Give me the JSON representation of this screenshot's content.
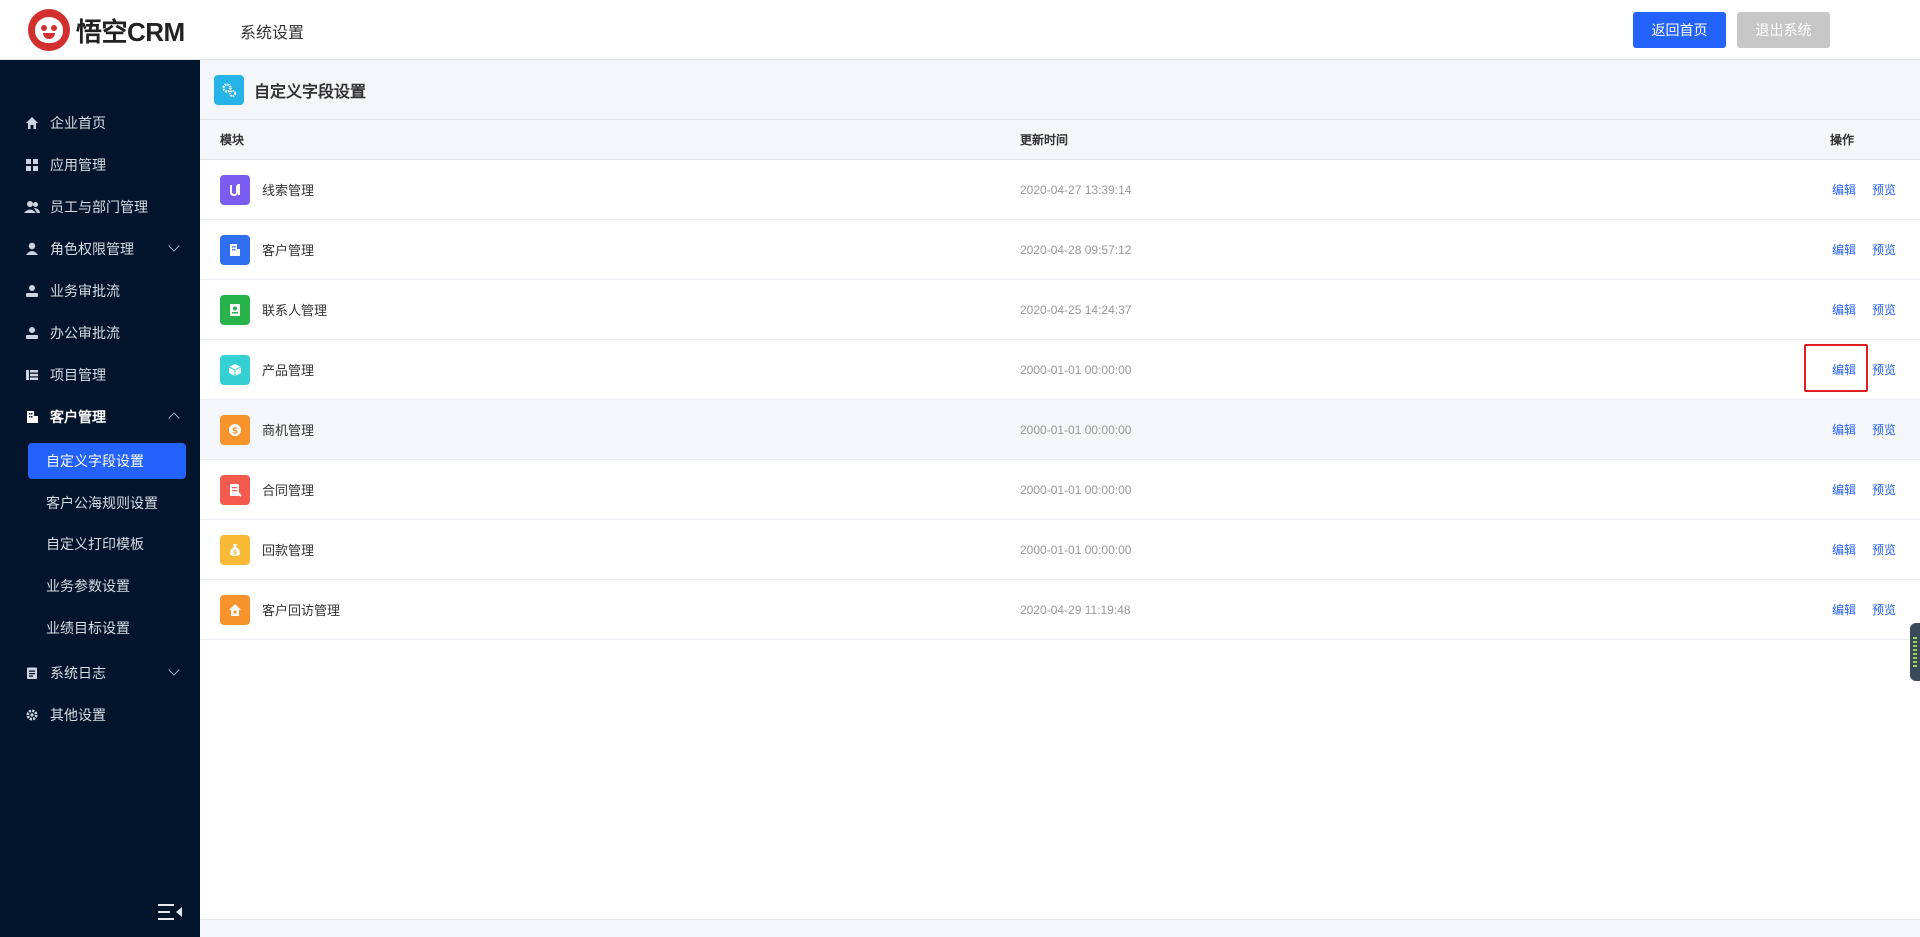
{
  "header": {
    "logo_text": "悟空CRM",
    "title": "系统设置",
    "home_button": "返回首页",
    "exit_button": "退出系统"
  },
  "sidebar": {
    "items": [
      {
        "label": "企业首页",
        "icon": "home-icon"
      },
      {
        "label": "应用管理",
        "icon": "apps-grid-icon"
      },
      {
        "label": "员工与部门管理",
        "icon": "users-icon"
      },
      {
        "label": "角色权限管理",
        "icon": "user-icon"
      },
      {
        "label": "业务审批流",
        "icon": "approval-icon"
      },
      {
        "label": "办公审批流",
        "icon": "approval-icon"
      },
      {
        "label": "项目管理",
        "icon": "project-icon"
      },
      {
        "label": "客户管理",
        "icon": "building-icon"
      },
      {
        "label": "系统日志",
        "icon": "log-icon"
      },
      {
        "label": "其他设置",
        "icon": "gear-icon"
      }
    ],
    "sub_items": [
      {
        "label": "自定义字段设置",
        "active": true
      },
      {
        "label": "客户公海规则设置",
        "active": false
      },
      {
        "label": "自定义打印模板",
        "active": false
      },
      {
        "label": "业务参数设置",
        "active": false
      },
      {
        "label": "业绩目标设置",
        "active": false
      }
    ]
  },
  "page": {
    "title": "自定义字段设置",
    "columns": {
      "module": "模块",
      "time": "更新时间",
      "action": "操作"
    },
    "edit_label": "编辑",
    "preview_label": "预览",
    "rows": [
      {
        "name": "线索管理",
        "time": "2020-04-27 13:39:14",
        "color": "#7b5cf0",
        "icon": "leads-icon"
      },
      {
        "name": "客户管理",
        "time": "2020-04-28 09:57:12",
        "color": "#2f6ff0",
        "icon": "customer-icon"
      },
      {
        "name": "联系人管理",
        "time": "2020-04-25 14:24:37",
        "color": "#27b24a",
        "icon": "contacts-icon"
      },
      {
        "name": "产品管理",
        "time": "2000-01-01 00:00:00",
        "color": "#35d0d4",
        "icon": "product-icon"
      },
      {
        "name": "商机管理",
        "time": "2000-01-01 00:00:00",
        "color": "#f7932b",
        "icon": "opportunity-icon"
      },
      {
        "name": "合同管理",
        "time": "2000-01-01 00:00:00",
        "color": "#f25b4e",
        "icon": "contract-icon"
      },
      {
        "name": "回款管理",
        "time": "2000-01-01 00:00:00",
        "color": "#f7b936",
        "icon": "payment-icon"
      },
      {
        "name": "客户回访管理",
        "time": "2020-04-29 11:19:48",
        "color": "#f7932b",
        "icon": "visit-icon"
      }
    ]
  }
}
